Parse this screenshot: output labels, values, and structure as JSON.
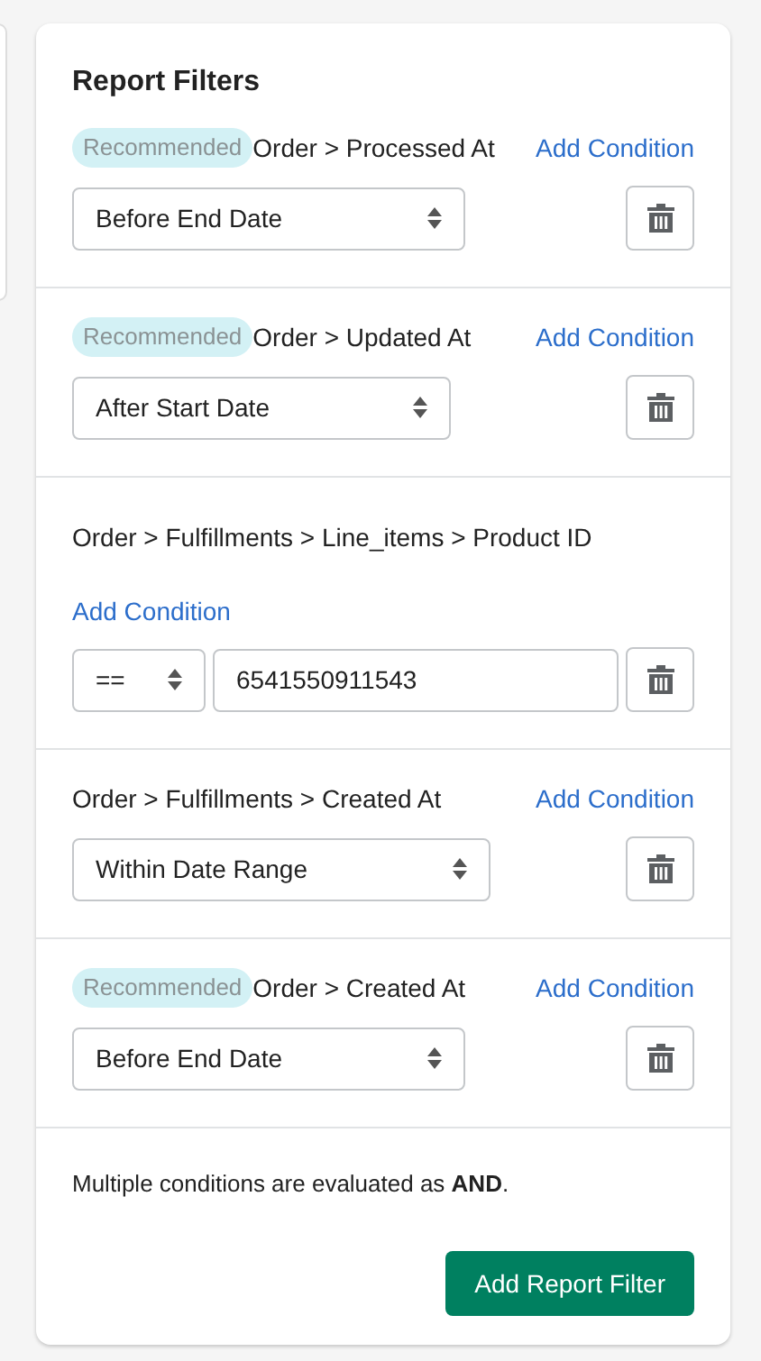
{
  "title": "Report Filters",
  "filters": [
    {
      "kind": "select",
      "badge": "Recommended",
      "path": "Order > Processed At",
      "add_link": "Add Condition",
      "value": "Before End Date"
    },
    {
      "kind": "select",
      "badge": "Recommended",
      "path": "Order > Updated At",
      "add_link": "Add Condition",
      "value": "After Start Date"
    },
    {
      "kind": "compare",
      "path": "Order > Fulfillments > Line_items > Product ID",
      "add_link": "Add Condition",
      "operator": "==",
      "value": "6541550911543"
    },
    {
      "kind": "select",
      "path": "Order > Fulfillments > Created At",
      "add_link": "Add Condition",
      "value": "Within Date Range"
    },
    {
      "kind": "select",
      "badge": "Recommended",
      "path": "Order > Created At",
      "add_link": "Add Condition",
      "value": "Before End Date"
    }
  ],
  "note": "Multiple conditions are evaluated as **AND**.",
  "submit_button": "Add Report Filter"
}
